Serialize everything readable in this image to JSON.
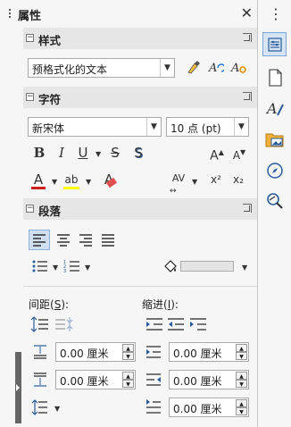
{
  "sidebar": {
    "title": "属性",
    "close_glyph": "✕",
    "menu_glyph": "⋮"
  },
  "styles_panel": {
    "header": "样式",
    "paragraph_style": "预格式化的文本"
  },
  "character_panel": {
    "header": "字符",
    "font_name": "新宋体",
    "font_size": "10 点 (pt)"
  },
  "paragraph_panel": {
    "header": "段落",
    "spacing_label_prefix": "间距(",
    "spacing_accel": "S",
    "spacing_label_suffix": "):",
    "indent_label_prefix": "缩进(",
    "indent_accel": "I",
    "indent_label_suffix": "):",
    "above_spacing": "0.00 厘米",
    "below_spacing": "0.00 厘米",
    "before_indent": "0.00 厘米",
    "after_indent": "0.00 厘米",
    "first_line_indent": "0.00 厘米"
  },
  "glyphs": {
    "bold": "B",
    "italic": "I",
    "underline": "U",
    "strike": "S",
    "shadow": "S",
    "font_color": "A",
    "highlight": "ab",
    "clear": "A",
    "grow": "A",
    "shrink": "A",
    "spacing": "AV",
    "superscript": "x²",
    "subscript": "x₂"
  },
  "colors": {
    "font_color_bar": "#c9211e",
    "highlight_bar": "#ffff00",
    "accent_blue": "#2a5b9a"
  }
}
